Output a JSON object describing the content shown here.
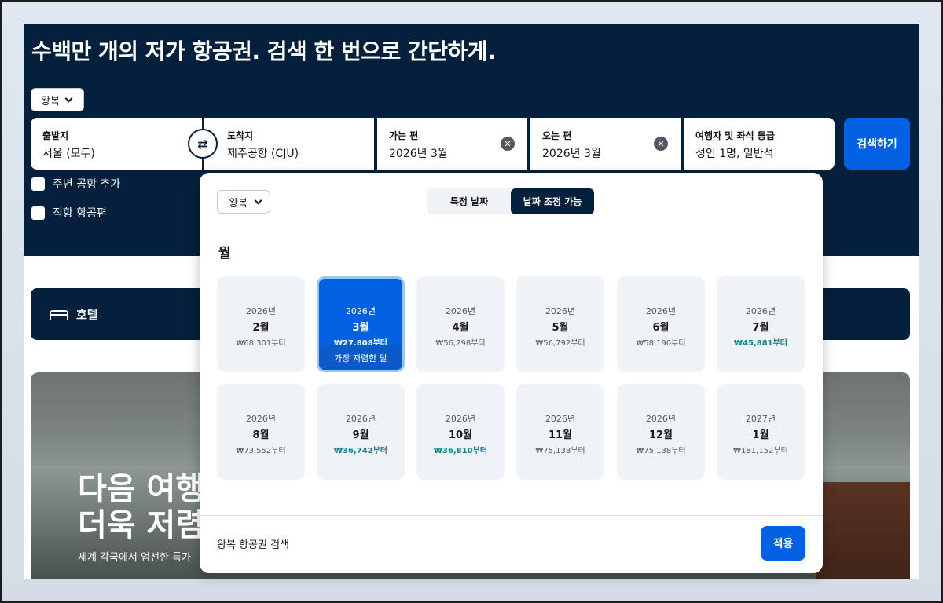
{
  "headline": "수백만 개의 저가 항공권. 검색 한 번으로 간단하게.",
  "trip_type": "왕복",
  "fields": {
    "origin": {
      "label": "출발지",
      "value": "서울 (모두)"
    },
    "destination": {
      "label": "도착지",
      "value": "제주공항 (CJU)"
    },
    "depart": {
      "label": "가는 편",
      "value": "2026년 3월"
    },
    "return": {
      "label": "오는 편",
      "value": "2026년 3월"
    },
    "travellers": {
      "label": "여행자 및 좌석 등급",
      "value": "성인 1명, 일반석"
    }
  },
  "search_label": "검색하기",
  "checkboxes": {
    "nearby": "주변 공항 추가",
    "direct": "직항 항공편"
  },
  "hotel_label": "호텔",
  "promo": {
    "title_line1": "다음 여행",
    "title_line2": "더욱 저렴",
    "subtitle": "세계 각국에서 엄선한 특가"
  },
  "popup": {
    "trip_type": "왕복",
    "tab_specific": "특정 날짜",
    "tab_flexible": "날짜 조정 가능",
    "section_title": "월",
    "selected_badge": "가장 저렴한 달",
    "months": [
      {
        "year": "2026년",
        "month": "2월",
        "price": "₩68,301부터",
        "cheap": false
      },
      {
        "year": "2026년",
        "month": "3월",
        "price": "₩27,808부터",
        "cheap": false,
        "selected": true
      },
      {
        "year": "2026년",
        "month": "4월",
        "price": "₩56,298부터",
        "cheap": false
      },
      {
        "year": "2026년",
        "month": "5월",
        "price": "₩56,792부터",
        "cheap": false
      },
      {
        "year": "2026년",
        "month": "6월",
        "price": "₩58,190부터",
        "cheap": false
      },
      {
        "year": "2026년",
        "month": "7월",
        "price": "₩45,881부터",
        "cheap": true
      },
      {
        "year": "2026년",
        "month": "8월",
        "price": "₩73,552부터",
        "cheap": false
      },
      {
        "year": "2026년",
        "month": "9월",
        "price": "₩36,742부터",
        "cheap": true
      },
      {
        "year": "2026년",
        "month": "10월",
        "price": "₩36,810부터",
        "cheap": true
      },
      {
        "year": "2026년",
        "month": "11월",
        "price": "₩75,138부터",
        "cheap": false
      },
      {
        "year": "2026년",
        "month": "12월",
        "price": "₩75,138부터",
        "cheap": false
      },
      {
        "year": "2027년",
        "month": "1월",
        "price": "₩181,152부터",
        "cheap": false
      }
    ],
    "footer_text": "왕복 항공권 검색",
    "apply_label": "적용"
  },
  "colors": {
    "navy": "#05203c",
    "primary": "#0062e3",
    "cheap_price": "#0c838a"
  }
}
